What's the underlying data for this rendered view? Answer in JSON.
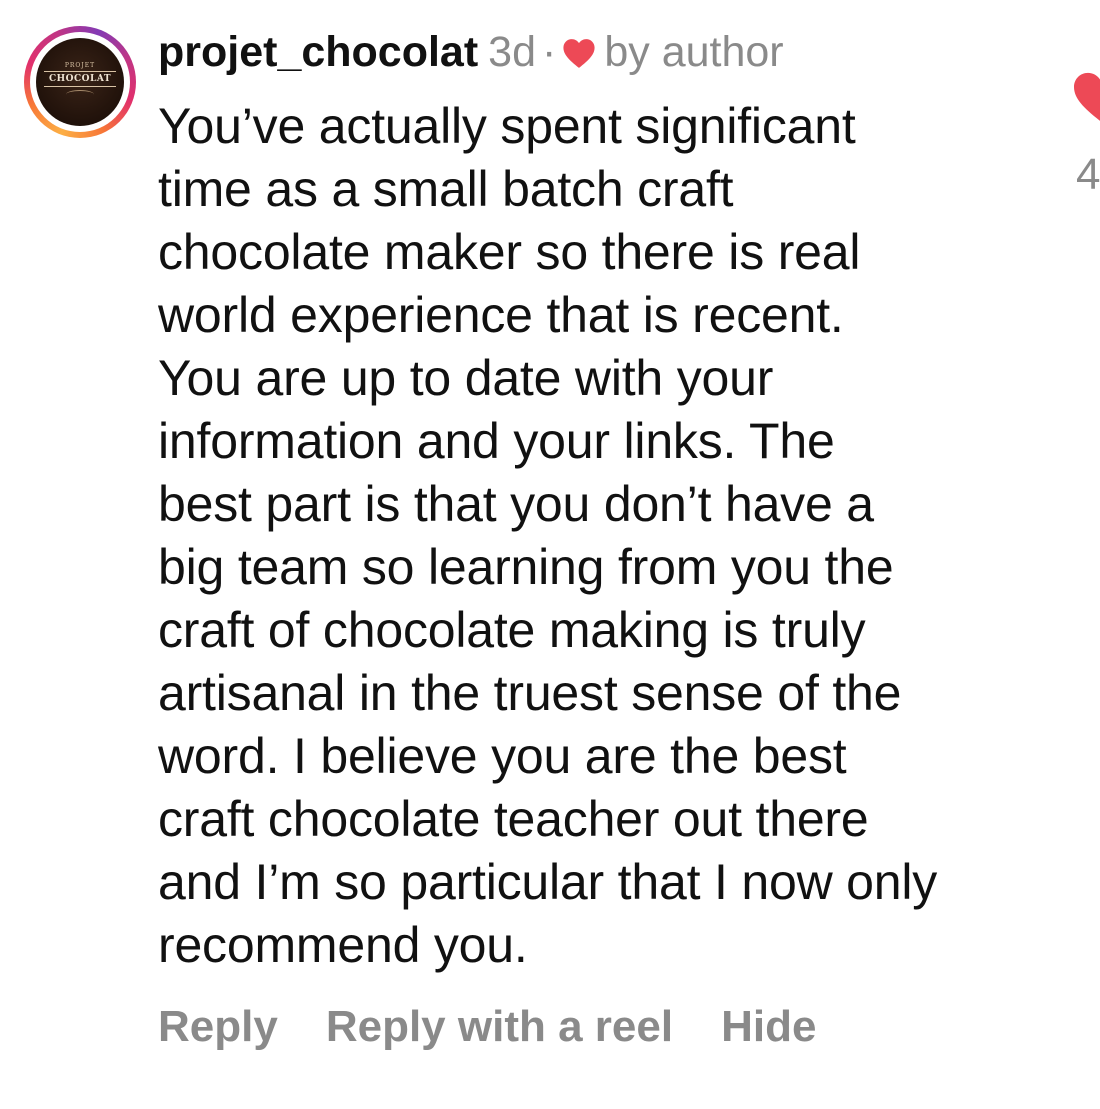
{
  "avatar": {
    "small_text": "PROJET",
    "brand_text": "CHOCOLAT"
  },
  "comment": {
    "username": "projet_chocolat",
    "timestamp": "3d",
    "separator": "·",
    "liked_by": "by author",
    "lines": [
      "You’ve actually spent significant",
      "time as a small batch craft",
      "chocolate maker so there is real",
      "world experience that is recent.",
      "You are up to date with your",
      "information and your links. The",
      "best part is that you don’t have a",
      "big team so learning from you the",
      "craft of chocolate making is truly",
      "artisanal in the truest sense of the",
      "word. I believe you are the best",
      "craft chocolate teacher out there",
      "and I’m so particular that I now only",
      "recommend you."
    ],
    "like_count": "4"
  },
  "actions": {
    "reply": "Reply",
    "reply_reel": "Reply with a reel",
    "hide": "Hide"
  },
  "colors": {
    "heart": "#ed4956",
    "muted": "#8a8a8a",
    "text": "#111111"
  }
}
